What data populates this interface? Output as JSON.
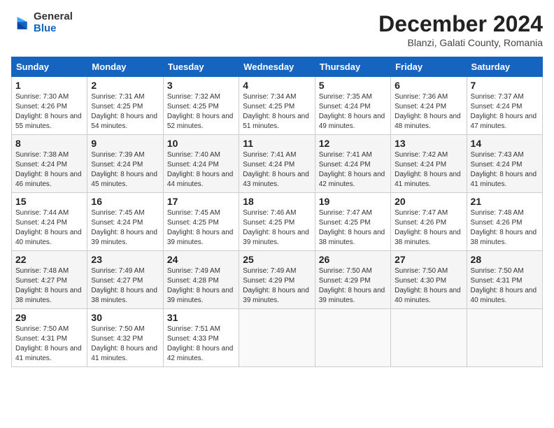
{
  "header": {
    "logo_general": "General",
    "logo_blue": "Blue",
    "month_title": "December 2024",
    "subtitle": "Blanzi, Galati County, Romania"
  },
  "calendar": {
    "days_of_week": [
      "Sunday",
      "Monday",
      "Tuesday",
      "Wednesday",
      "Thursday",
      "Friday",
      "Saturday"
    ],
    "weeks": [
      [
        null,
        {
          "day": 2,
          "sunrise": "7:31 AM",
          "sunset": "4:25 PM",
          "daylight": "8 hours and 54 minutes"
        },
        {
          "day": 3,
          "sunrise": "7:32 AM",
          "sunset": "4:25 PM",
          "daylight": "8 hours and 52 minutes"
        },
        {
          "day": 4,
          "sunrise": "7:34 AM",
          "sunset": "4:25 PM",
          "daylight": "8 hours and 51 minutes"
        },
        {
          "day": 5,
          "sunrise": "7:35 AM",
          "sunset": "4:24 PM",
          "daylight": "8 hours and 49 minutes"
        },
        {
          "day": 6,
          "sunrise": "7:36 AM",
          "sunset": "4:24 PM",
          "daylight": "8 hours and 48 minutes"
        },
        {
          "day": 7,
          "sunrise": "7:37 AM",
          "sunset": "4:24 PM",
          "daylight": "8 hours and 47 minutes"
        }
      ],
      [
        {
          "day": 1,
          "sunrise": "7:30 AM",
          "sunset": "4:26 PM",
          "daylight": "8 hours and 55 minutes"
        },
        {
          "day": 9,
          "sunrise": "7:39 AM",
          "sunset": "4:24 PM",
          "daylight": "8 hours and 45 minutes"
        },
        {
          "day": 10,
          "sunrise": "7:40 AM",
          "sunset": "4:24 PM",
          "daylight": "8 hours and 44 minutes"
        },
        {
          "day": 11,
          "sunrise": "7:41 AM",
          "sunset": "4:24 PM",
          "daylight": "8 hours and 43 minutes"
        },
        {
          "day": 12,
          "sunrise": "7:41 AM",
          "sunset": "4:24 PM",
          "daylight": "8 hours and 42 minutes"
        },
        {
          "day": 13,
          "sunrise": "7:42 AM",
          "sunset": "4:24 PM",
          "daylight": "8 hours and 41 minutes"
        },
        {
          "day": 14,
          "sunrise": "7:43 AM",
          "sunset": "4:24 PM",
          "daylight": "8 hours and 41 minutes"
        }
      ],
      [
        {
          "day": 8,
          "sunrise": "7:38 AM",
          "sunset": "4:24 PM",
          "daylight": "8 hours and 46 minutes"
        },
        {
          "day": 16,
          "sunrise": "7:45 AM",
          "sunset": "4:24 PM",
          "daylight": "8 hours and 39 minutes"
        },
        {
          "day": 17,
          "sunrise": "7:45 AM",
          "sunset": "4:25 PM",
          "daylight": "8 hours and 39 minutes"
        },
        {
          "day": 18,
          "sunrise": "7:46 AM",
          "sunset": "4:25 PM",
          "daylight": "8 hours and 39 minutes"
        },
        {
          "day": 19,
          "sunrise": "7:47 AM",
          "sunset": "4:25 PM",
          "daylight": "8 hours and 38 minutes"
        },
        {
          "day": 20,
          "sunrise": "7:47 AM",
          "sunset": "4:26 PM",
          "daylight": "8 hours and 38 minutes"
        },
        {
          "day": 21,
          "sunrise": "7:48 AM",
          "sunset": "4:26 PM",
          "daylight": "8 hours and 38 minutes"
        }
      ],
      [
        {
          "day": 15,
          "sunrise": "7:44 AM",
          "sunset": "4:24 PM",
          "daylight": "8 hours and 40 minutes"
        },
        {
          "day": 23,
          "sunrise": "7:49 AM",
          "sunset": "4:27 PM",
          "daylight": "8 hours and 38 minutes"
        },
        {
          "day": 24,
          "sunrise": "7:49 AM",
          "sunset": "4:28 PM",
          "daylight": "8 hours and 39 minutes"
        },
        {
          "day": 25,
          "sunrise": "7:49 AM",
          "sunset": "4:29 PM",
          "daylight": "8 hours and 39 minutes"
        },
        {
          "day": 26,
          "sunrise": "7:50 AM",
          "sunset": "4:29 PM",
          "daylight": "8 hours and 39 minutes"
        },
        {
          "day": 27,
          "sunrise": "7:50 AM",
          "sunset": "4:30 PM",
          "daylight": "8 hours and 40 minutes"
        },
        {
          "day": 28,
          "sunrise": "7:50 AM",
          "sunset": "4:31 PM",
          "daylight": "8 hours and 40 minutes"
        }
      ],
      [
        {
          "day": 22,
          "sunrise": "7:48 AM",
          "sunset": "4:27 PM",
          "daylight": "8 hours and 38 minutes"
        },
        {
          "day": 30,
          "sunrise": "7:50 AM",
          "sunset": "4:32 PM",
          "daylight": "8 hours and 41 minutes"
        },
        {
          "day": 31,
          "sunrise": "7:51 AM",
          "sunset": "4:33 PM",
          "daylight": "8 hours and 42 minutes"
        },
        null,
        null,
        null,
        null
      ],
      [
        {
          "day": 29,
          "sunrise": "7:50 AM",
          "sunset": "4:31 PM",
          "daylight": "8 hours and 41 minutes"
        },
        null,
        null,
        null,
        null,
        null,
        null
      ]
    ]
  }
}
